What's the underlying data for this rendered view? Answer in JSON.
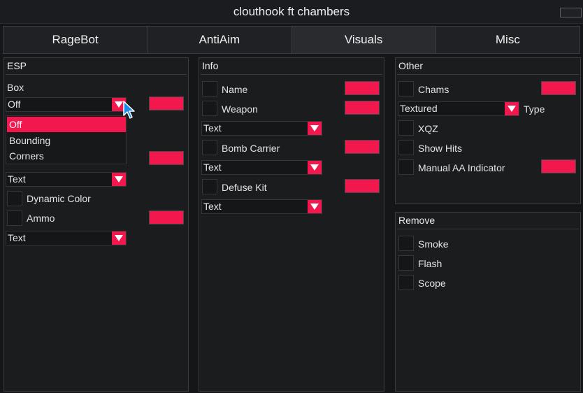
{
  "window": {
    "title": "clouthook ft chambers"
  },
  "tabs": [
    {
      "label": "RageBot"
    },
    {
      "label": "AntiAim"
    },
    {
      "label": "Visuals"
    },
    {
      "label": "Misc"
    }
  ],
  "active_tab": "Visuals",
  "colors": {
    "accent": "#f2184e",
    "background": "#151618",
    "panel": "#1b1c1e",
    "border": "#3a3b3f"
  },
  "esp": {
    "title": "ESP",
    "box_label": "Box",
    "box_select": "Off",
    "box_options": [
      "Off",
      "Bounding",
      "Corners"
    ],
    "name_select": "Text",
    "dynamic_color": "Dynamic Color",
    "ammo": "Ammo",
    "ammo_select": "Text"
  },
  "info": {
    "title": "Info",
    "name": "Name",
    "weapon": "Weapon",
    "weapon_select": "Text",
    "bomb_carrier": "Bomb Carrier",
    "bomb_select": "Text",
    "defuse_kit": "Defuse Kit",
    "defuse_select": "Text"
  },
  "other": {
    "title": "Other",
    "chams": "Chams",
    "chams_select": "Textured",
    "type_label": "Type",
    "xqz": "XQZ",
    "show_hits": "Show Hits",
    "manual_aa": "Manual AA Indicator"
  },
  "remove": {
    "title": "Remove",
    "smoke": "Smoke",
    "flash": "Flash",
    "scope": "Scope"
  }
}
